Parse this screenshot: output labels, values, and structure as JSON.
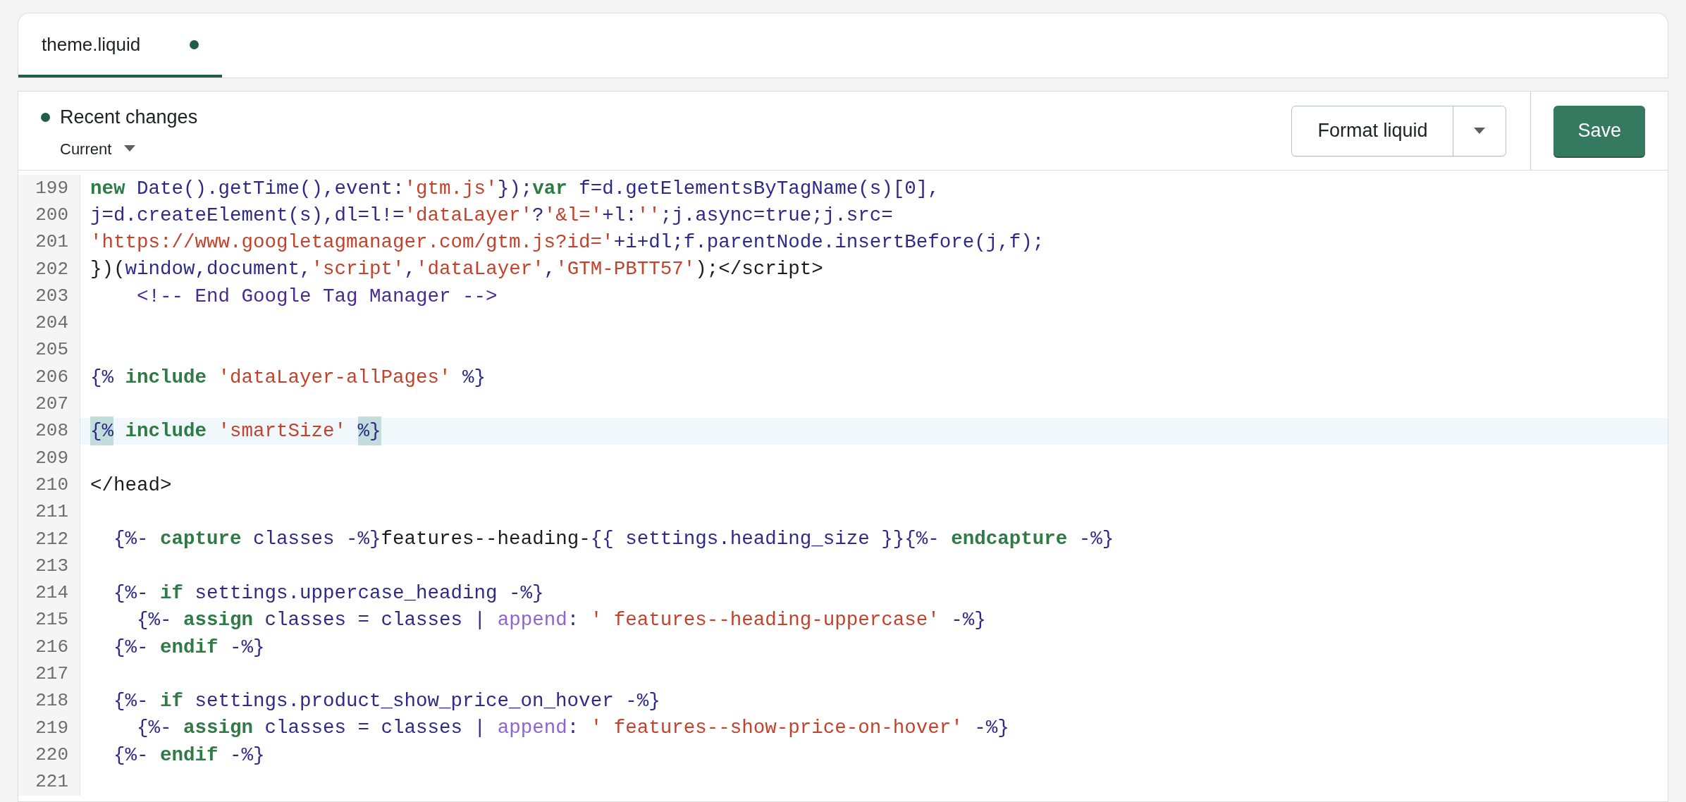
{
  "tabs": [
    {
      "label": "theme.liquid",
      "selected": true,
      "modified": true
    }
  ],
  "toolbar": {
    "title": "Recent changes",
    "version": "Current",
    "format_button": "Format liquid",
    "save_button": "Save"
  },
  "editor": {
    "lines": [
      {
        "number": "199",
        "selected": false,
        "tokens": [
          {
            "kind": "kw",
            "text": "new"
          },
          {
            "kind": "id",
            "text": " Date().getTime(),event:"
          },
          {
            "kind": "str",
            "text": "'gtm.js'"
          },
          {
            "kind": "id",
            "text": "});"
          },
          {
            "kind": "kw",
            "text": "var"
          },
          {
            "kind": "id",
            "text": " f=d.getElementsByTagName(s)[0],"
          }
        ]
      },
      {
        "number": "200",
        "selected": false,
        "tokens": [
          {
            "kind": "id",
            "text": "j=d.createElement(s),dl=l!="
          },
          {
            "kind": "str",
            "text": "'dataLayer'"
          },
          {
            "kind": "id",
            "text": "?"
          },
          {
            "kind": "str",
            "text": "'&l='"
          },
          {
            "kind": "id",
            "text": "+l:"
          },
          {
            "kind": "str",
            "text": "''"
          },
          {
            "kind": "id",
            "text": ";j.async=true;j.src="
          }
        ]
      },
      {
        "number": "201",
        "selected": false,
        "tokens": [
          {
            "kind": "str",
            "text": "'https://www.googletagmanager.com/gtm.js?id='"
          },
          {
            "kind": "id",
            "text": "+i+dl;f.parentNode.insertBefore(j,f);"
          }
        ]
      },
      {
        "number": "202",
        "selected": false,
        "tokens": [
          {
            "kind": "plain",
            "text": "})("
          },
          {
            "kind": "id",
            "text": "window,document,"
          },
          {
            "kind": "str",
            "text": "'script'"
          },
          {
            "kind": "id",
            "text": ","
          },
          {
            "kind": "str",
            "text": "'dataLayer'"
          },
          {
            "kind": "id",
            "text": ","
          },
          {
            "kind": "str",
            "text": "'GTM-PBTT57'"
          },
          {
            "kind": "plain",
            "text": ");</script>"
          }
        ]
      },
      {
        "number": "203",
        "selected": false,
        "tokens": [
          {
            "kind": "cm",
            "text": "    <!-- End Google Tag Manager -->"
          }
        ]
      },
      {
        "number": "204",
        "selected": false
      },
      {
        "number": "205",
        "selected": false
      },
      {
        "number": "206",
        "selected": false,
        "tokens": [
          {
            "kind": "delim",
            "text": "{%"
          },
          {
            "kind": "kw",
            "text": " include"
          },
          {
            "kind": "str",
            "text": " 'dataLayer-allPages'"
          },
          {
            "kind": "delim",
            "text": " %}"
          }
        ]
      },
      {
        "number": "207",
        "selected": false
      },
      {
        "number": "208",
        "selected": true,
        "tokens": [
          {
            "kind": "match",
            "text": "{%"
          },
          {
            "kind": "kw",
            "text": " include"
          },
          {
            "kind": "str",
            "text": " 'smartSize' "
          },
          {
            "kind": "match",
            "text": "%}"
          }
        ]
      },
      {
        "number": "209",
        "selected": false
      },
      {
        "number": "210",
        "selected": false,
        "tokens": [
          {
            "kind": "plain",
            "text": "</head>"
          }
        ]
      },
      {
        "number": "211",
        "selected": false
      },
      {
        "number": "212",
        "selected": false,
        "tokens": [
          {
            "kind": "delim",
            "text": "  {%-"
          },
          {
            "kind": "kw",
            "text": " capture"
          },
          {
            "kind": "id",
            "text": " classes "
          },
          {
            "kind": "delim",
            "text": "-%}"
          },
          {
            "kind": "plain",
            "text": "features--heading-"
          },
          {
            "kind": "delim",
            "text": "{{"
          },
          {
            "kind": "id",
            "text": " settings.heading_size "
          },
          {
            "kind": "delim",
            "text": "}}{%-"
          },
          {
            "kind": "kw",
            "text": " endcapture"
          },
          {
            "kind": "delim",
            "text": " -%}"
          }
        ]
      },
      {
        "number": "213",
        "selected": false
      },
      {
        "number": "214",
        "selected": false,
        "tokens": [
          {
            "kind": "delim",
            "text": "  {%-"
          },
          {
            "kind": "kw",
            "text": " if"
          },
          {
            "kind": "id",
            "text": " settings.uppercase_heading "
          },
          {
            "kind": "delim",
            "text": "-%}"
          }
        ]
      },
      {
        "number": "215",
        "selected": false,
        "tokens": [
          {
            "kind": "delim",
            "text": "    {%-"
          },
          {
            "kind": "kw",
            "text": " assign"
          },
          {
            "kind": "id",
            "text": " classes = classes | "
          },
          {
            "kind": "filter",
            "text": "append"
          },
          {
            "kind": "id",
            "text": ": "
          },
          {
            "kind": "str",
            "text": "' features--heading-uppercase'"
          },
          {
            "kind": "delim",
            "text": " -%}"
          }
        ]
      },
      {
        "number": "216",
        "selected": false,
        "tokens": [
          {
            "kind": "delim",
            "text": "  {%-"
          },
          {
            "kind": "kw",
            "text": " endif"
          },
          {
            "kind": "delim",
            "text": " -%}"
          }
        ]
      },
      {
        "number": "217",
        "selected": false
      },
      {
        "number": "218",
        "selected": false,
        "tokens": [
          {
            "kind": "delim",
            "text": "  {%-"
          },
          {
            "kind": "kw",
            "text": " if"
          },
          {
            "kind": "id",
            "text": " settings.product_show_price_on_hover "
          },
          {
            "kind": "delim",
            "text": "-%}"
          }
        ]
      },
      {
        "number": "219",
        "selected": false,
        "tokens": [
          {
            "kind": "delim",
            "text": "    {%-"
          },
          {
            "kind": "kw",
            "text": " assign"
          },
          {
            "kind": "id",
            "text": " classes = classes | "
          },
          {
            "kind": "filter",
            "text": "append"
          },
          {
            "kind": "id",
            "text": ": "
          },
          {
            "kind": "str",
            "text": "' features--show-price-on-hover'"
          },
          {
            "kind": "delim",
            "text": " -%}"
          }
        ]
      },
      {
        "number": "220",
        "selected": false,
        "tokens": [
          {
            "kind": "delim",
            "text": "  {%-"
          },
          {
            "kind": "kw",
            "text": " endif"
          },
          {
            "kind": "delim",
            "text": " -%}"
          }
        ]
      },
      {
        "number": "221",
        "selected": false
      }
    ]
  }
}
